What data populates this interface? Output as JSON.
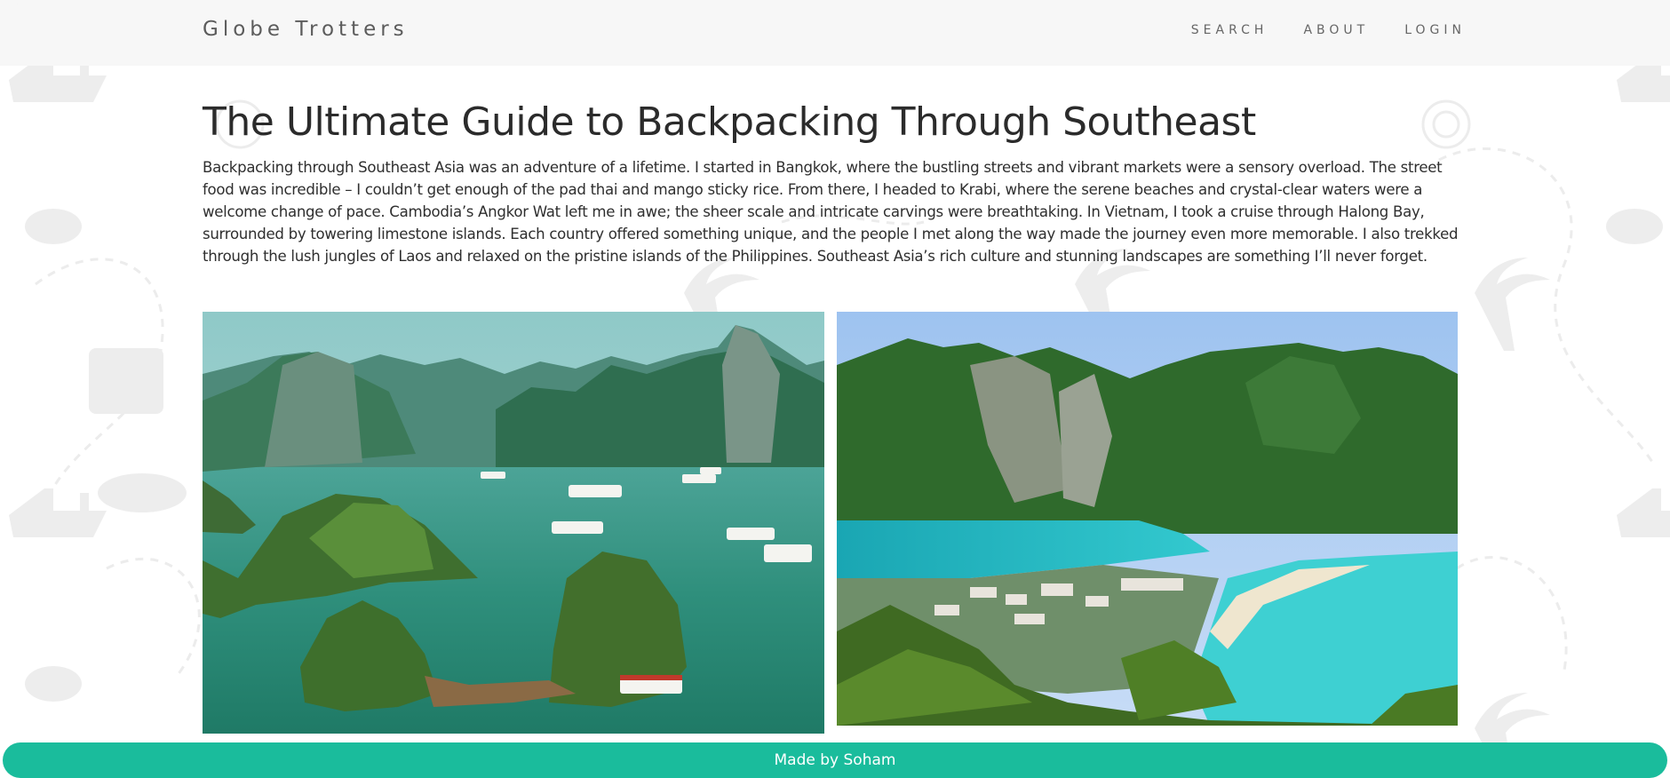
{
  "header": {
    "brand": "Globe Trotters",
    "nav": [
      {
        "label": "SEARCH"
      },
      {
        "label": "ABOUT"
      },
      {
        "label": "LOGIN"
      }
    ]
  },
  "article": {
    "title": "The Ultimate Guide to Backpacking Through Southeast",
    "body": "Backpacking through Southeast Asia was an adventure of a lifetime. I started in Bangkok, where the bustling streets and vibrant markets were a sensory overload. The street food was incredible – I couldn’t get enough of the pad thai and mango sticky rice. From there, I headed to Krabi, where the serene beaches and crystal-clear waters were a welcome change of pace. Cambodia’s Angkor Wat left me in awe; the sheer scale and intricate carvings were breathtaking. In Vietnam, I took a cruise through Halong Bay, surrounded by towering limestone islands. Each country offered something unique, and the people I met along the way made the journey even more memorable. I also trekked through the lush jungles of Laos and relaxed on the pristine islands of the Philippines. Southeast Asia’s rich culture and stunning landscapes are something I’ll never forget."
  },
  "footer": {
    "text": "Made by Soham"
  },
  "colors": {
    "accent": "#1abc9c",
    "header_bg": "#f7f7f7",
    "text": "#2b2b2b"
  }
}
